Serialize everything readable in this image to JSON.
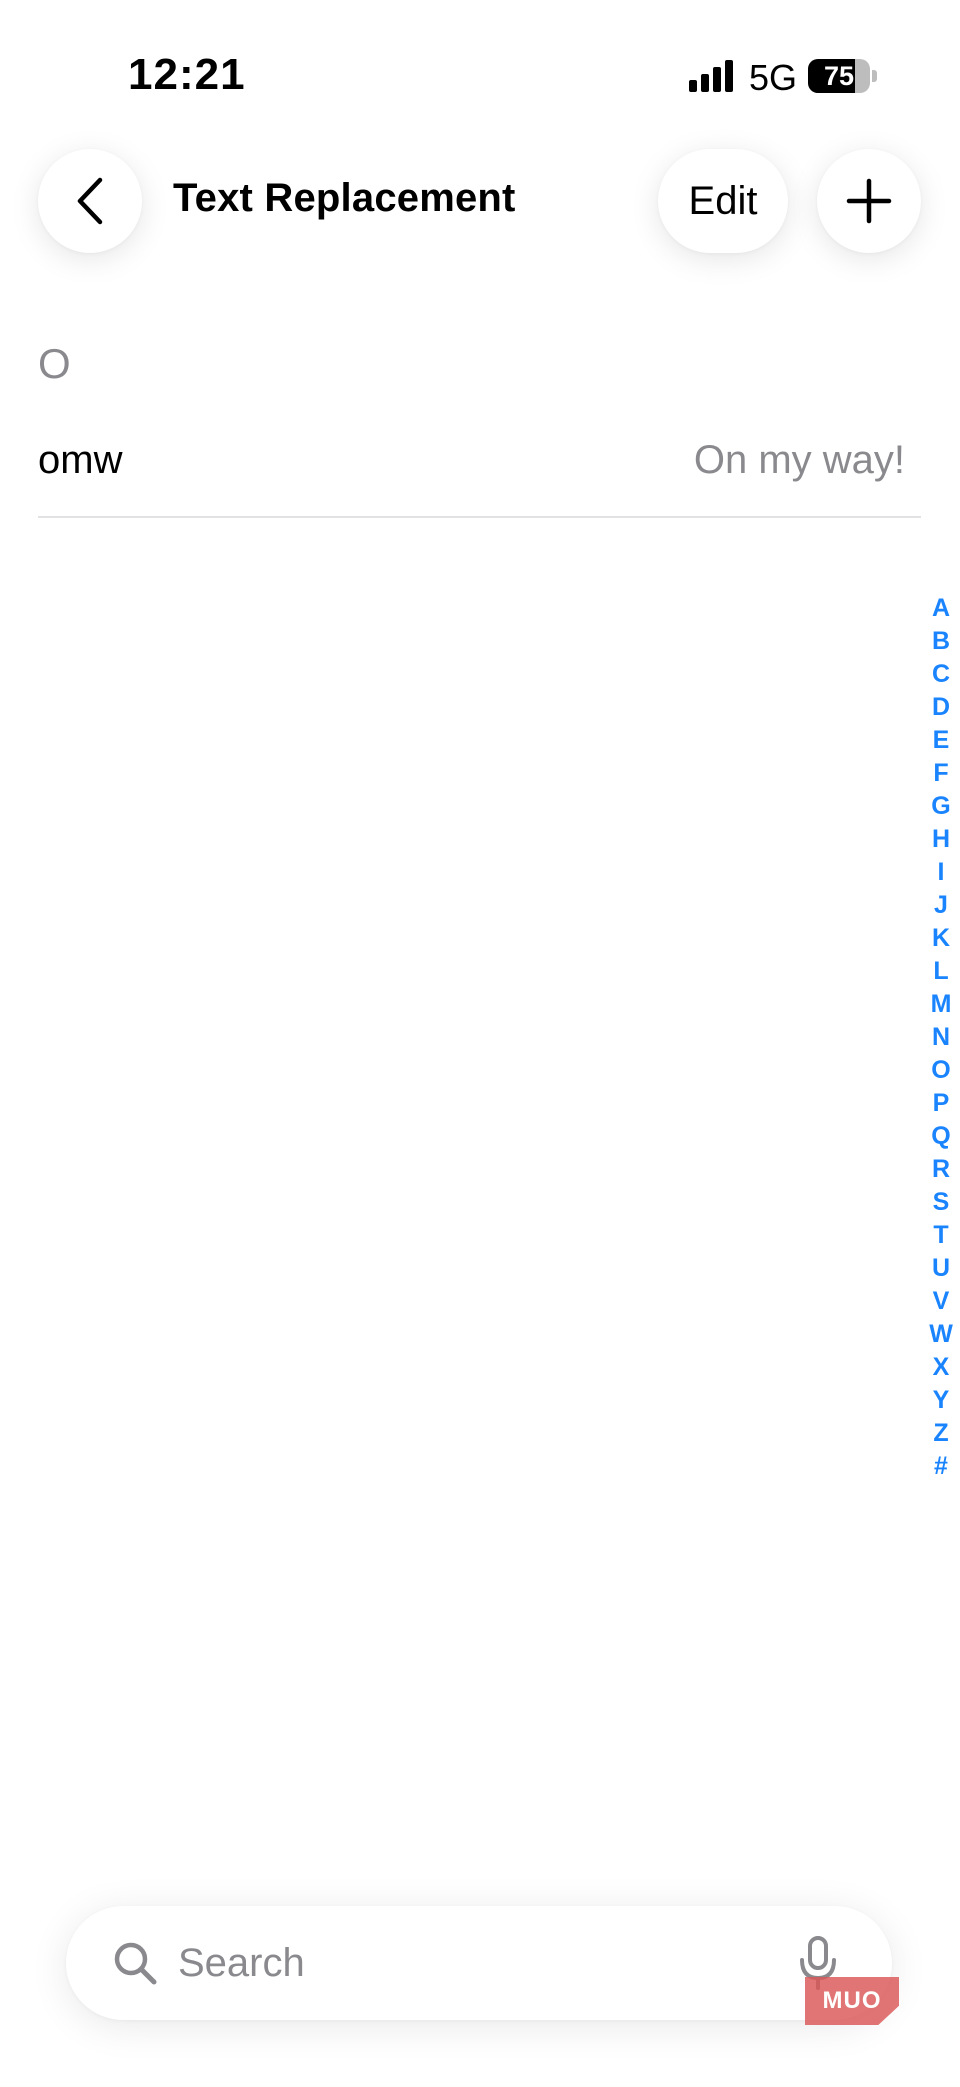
{
  "status_bar": {
    "time": "12:21",
    "network": "5G",
    "battery_level": "75",
    "battery_fraction": 0.75,
    "signal_bars": 4
  },
  "nav": {
    "back_icon": "chevron-left-icon",
    "title": "Text Replacement",
    "edit_label": "Edit",
    "add_icon": "plus-icon"
  },
  "list": {
    "sections": [
      {
        "header": "O",
        "rows": [
          {
            "shortcut": "omw",
            "phrase": "On my way!"
          }
        ]
      }
    ]
  },
  "index": {
    "letters": [
      "A",
      "B",
      "C",
      "D",
      "E",
      "F",
      "G",
      "H",
      "I",
      "J",
      "K",
      "L",
      "M",
      "N",
      "O",
      "P",
      "Q",
      "R",
      "S",
      "T",
      "U",
      "V",
      "W",
      "X",
      "Y",
      "Z",
      "#"
    ]
  },
  "search": {
    "placeholder": "Search",
    "value": "",
    "search_icon": "magnifier-icon",
    "mic_icon": "microphone-icon"
  },
  "watermark": {
    "text": "MUO"
  },
  "colors": {
    "accent": "#1a84ff",
    "secondary_text": "#8a8a8e",
    "separator": "#e2e2e4",
    "background": "#ffffff"
  }
}
